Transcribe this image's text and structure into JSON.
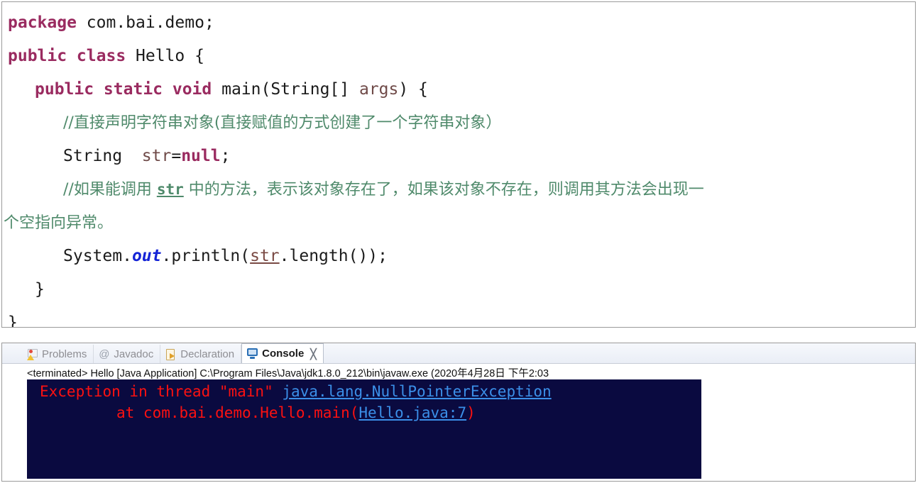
{
  "editor": {
    "lines": [
      {
        "indent": 0,
        "tokens": [
          {
            "t": "kw",
            "v": "package"
          },
          {
            "t": "plain",
            "v": " com.bai.demo;"
          }
        ]
      },
      {
        "indent": 0,
        "tokens": [
          {
            "t": "kw",
            "v": "public class"
          },
          {
            "t": "plain",
            "v": " Hello {"
          }
        ]
      },
      {
        "indent": 1,
        "tokens": [
          {
            "t": "kw",
            "v": "public static void"
          },
          {
            "t": "plain",
            "v": " main(String[] "
          },
          {
            "t": "param",
            "v": "args"
          },
          {
            "t": "plain",
            "v": ") {"
          }
        ]
      },
      {
        "indent": 2,
        "tokens": [
          {
            "t": "cmt",
            "v": "//直接声明字符串对象(直接赋值的方式创建了一个字符串对象）"
          }
        ]
      },
      {
        "indent": 2,
        "tokens": [
          {
            "t": "plain",
            "v": "String  "
          },
          {
            "t": "param",
            "v": "str"
          },
          {
            "t": "plain",
            "v": "="
          },
          {
            "t": "kw",
            "v": "null"
          },
          {
            "t": "plain",
            "v": ";"
          }
        ]
      },
      {
        "indent": 2,
        "wrap": true,
        "tokens": [
          {
            "t": "cmt",
            "v": "//如果能调用 "
          },
          {
            "t": "cmt-code",
            "v": "str"
          },
          {
            "t": "cmt",
            "v": " 中的方法，表示该对象存在了，如果该对象不存在，则调用其方法会出现一"
          }
        ]
      },
      {
        "indent": -1,
        "tokens": [
          {
            "t": "cmt",
            "v": "个空指向异常。"
          }
        ]
      },
      {
        "indent": 2,
        "tokens": [
          {
            "t": "plain",
            "v": "System."
          },
          {
            "t": "field",
            "v": "out"
          },
          {
            "t": "plain",
            "v": ".println("
          },
          {
            "t": "localvar",
            "v": "str"
          },
          {
            "t": "plain",
            "v": ".length());"
          }
        ]
      },
      {
        "indent": 1,
        "tokens": [
          {
            "t": "plain",
            "v": "}"
          }
        ]
      },
      {
        "indent": 0,
        "tokens": [
          {
            "t": "plain",
            "v": "}"
          }
        ]
      }
    ]
  },
  "console": {
    "tabs": [
      {
        "label": "Problems",
        "icon": "problems-icon",
        "active": false
      },
      {
        "label": "Javadoc",
        "icon": "at-icon",
        "active": false
      },
      {
        "label": "Declaration",
        "icon": "declaration-icon",
        "active": false
      },
      {
        "label": "Console",
        "icon": "monitor-icon",
        "active": true
      }
    ],
    "maximize_glyph": "╳",
    "launch_line": "<terminated> Hello [Java Application] C:\\Program Files\\Java\\jdk1.8.0_212\\bin\\javaw.exe  (2020年4月28日 下午2:03",
    "output": {
      "background": "#0a0a40",
      "error_color": "#fb1111",
      "link_color": "#3b8fe8",
      "lines": [
        {
          "indent": "ln-ind",
          "parts": [
            {
              "t": "err",
              "v": "Exception in thread \"main\" "
            },
            {
              "t": "link",
              "v": "java.lang.NullPointerException"
            }
          ]
        },
        {
          "indent": "ln-ind2",
          "parts": [
            {
              "t": "err",
              "v": "at com.bai.demo.Hello.main("
            },
            {
              "t": "link",
              "v": "Hello.java:7"
            },
            {
              "t": "err",
              "v": ")"
            }
          ]
        }
      ]
    }
  }
}
